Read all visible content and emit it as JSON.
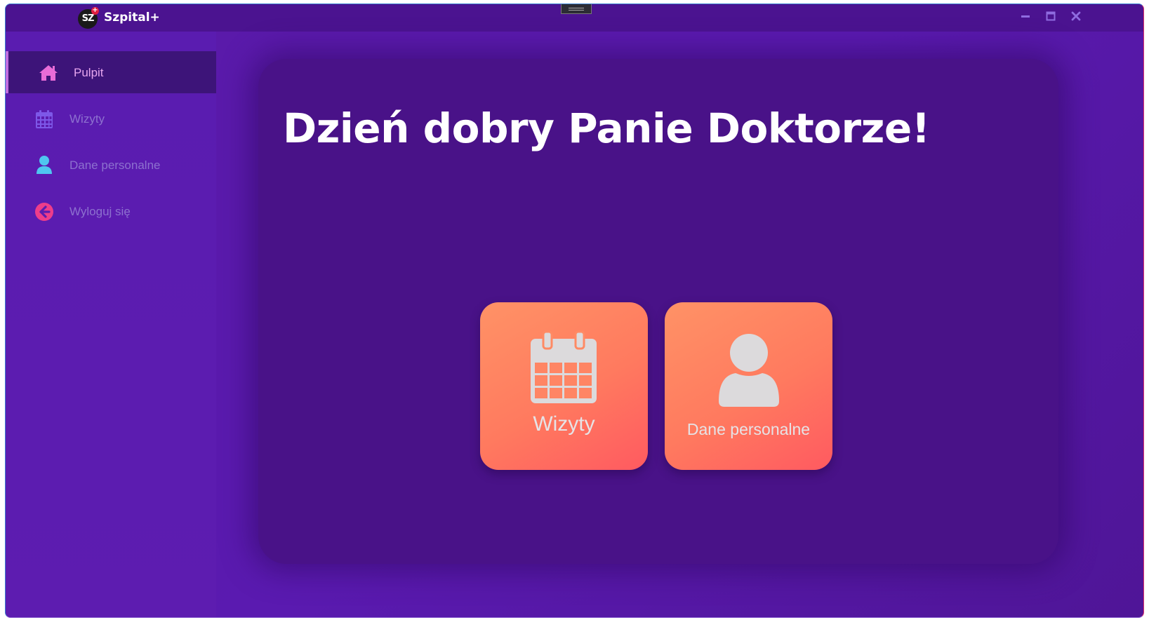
{
  "window": {
    "app_title": "Szpital+",
    "logo_text": "SZ",
    "controls": {
      "minimize_icon": "minimize-icon",
      "maximize_icon": "maximize-icon",
      "close_icon": "close-icon"
    }
  },
  "sidebar": {
    "items": [
      {
        "label": "Pulpit",
        "icon": "home-icon",
        "active": true,
        "color": "#e86cd7"
      },
      {
        "label": "Wizyty",
        "icon": "calendar-icon",
        "active": false,
        "color": "#7d58e8"
      },
      {
        "label": "Dane personalne",
        "icon": "user-icon",
        "active": false,
        "color": "#4fc6f0"
      },
      {
        "label": "Wyloguj się",
        "icon": "logout-arrow-icon",
        "active": false,
        "color": "#ee3d8a"
      }
    ]
  },
  "main": {
    "greeting": "Dzień dobry Panie Doktorze!",
    "tiles": [
      {
        "label": "Wizyty",
        "icon": "calendar-icon"
      },
      {
        "label": "Dane personalne",
        "icon": "user-icon"
      }
    ]
  },
  "colors": {
    "window_bg": "#5a1aa8",
    "card_bg": "#491288",
    "tile_gradient_start": "#ff9266",
    "tile_gradient_end": "#ff5a60",
    "inactive_label": "#8d71cf",
    "active_label": "#e6a6ef"
  }
}
